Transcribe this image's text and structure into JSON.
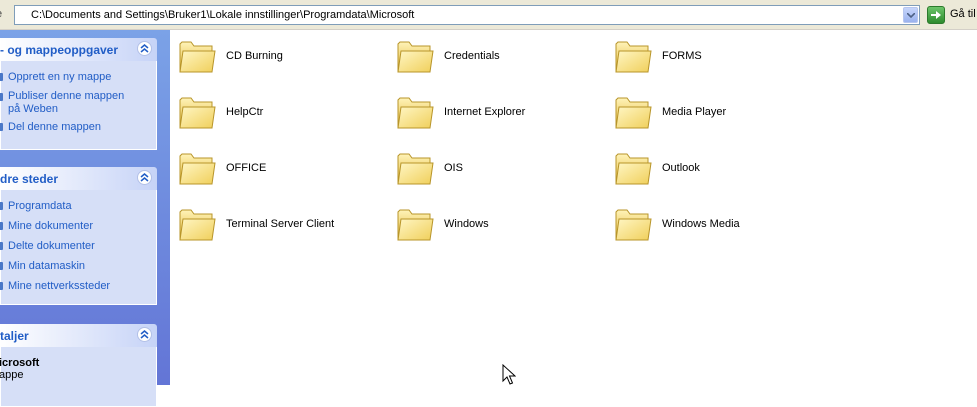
{
  "address_bar": {
    "label": "e",
    "path": "C:\\Documents and Settings\\Bruker1\\Lokale innstillinger\\Programdata\\Microsoft",
    "go_label": "Gå til"
  },
  "task_pane": {
    "file_tasks": {
      "title": "- og mappeoppgaver",
      "items": [
        "Opprett en ny mappe",
        "Publiser denne mappen på Weben",
        "Del denne mappen"
      ]
    },
    "other_places": {
      "title": "dre steder",
      "items": [
        "Programdata",
        "Mine dokumenter",
        "Delte dokumenter",
        "Min datamaskin",
        "Mine nettverkssteder"
      ]
    },
    "details": {
      "title": "taljer",
      "name": "icrosoft",
      "type": "appe"
    }
  },
  "folders": [
    "CD Burning",
    "Credentials",
    "FORMS",
    "HelpCtr",
    "Internet Explorer",
    "Media Player",
    "OFFICE",
    "OIS",
    "Outlook",
    "Terminal Server Client",
    "Windows",
    "Windows Media"
  ],
  "colors": {
    "task_link": "#215dc6",
    "pane_bg": "#6375d6",
    "panel_body": "#d6dff7",
    "folder_yellow": "#f4d66b"
  },
  "icons": {
    "folder": "folder-icon",
    "go": "go-arrow-icon",
    "collapse": "chevron-up-icon",
    "dropdown": "chevron-down-icon",
    "cursor": "mouse-cursor"
  }
}
